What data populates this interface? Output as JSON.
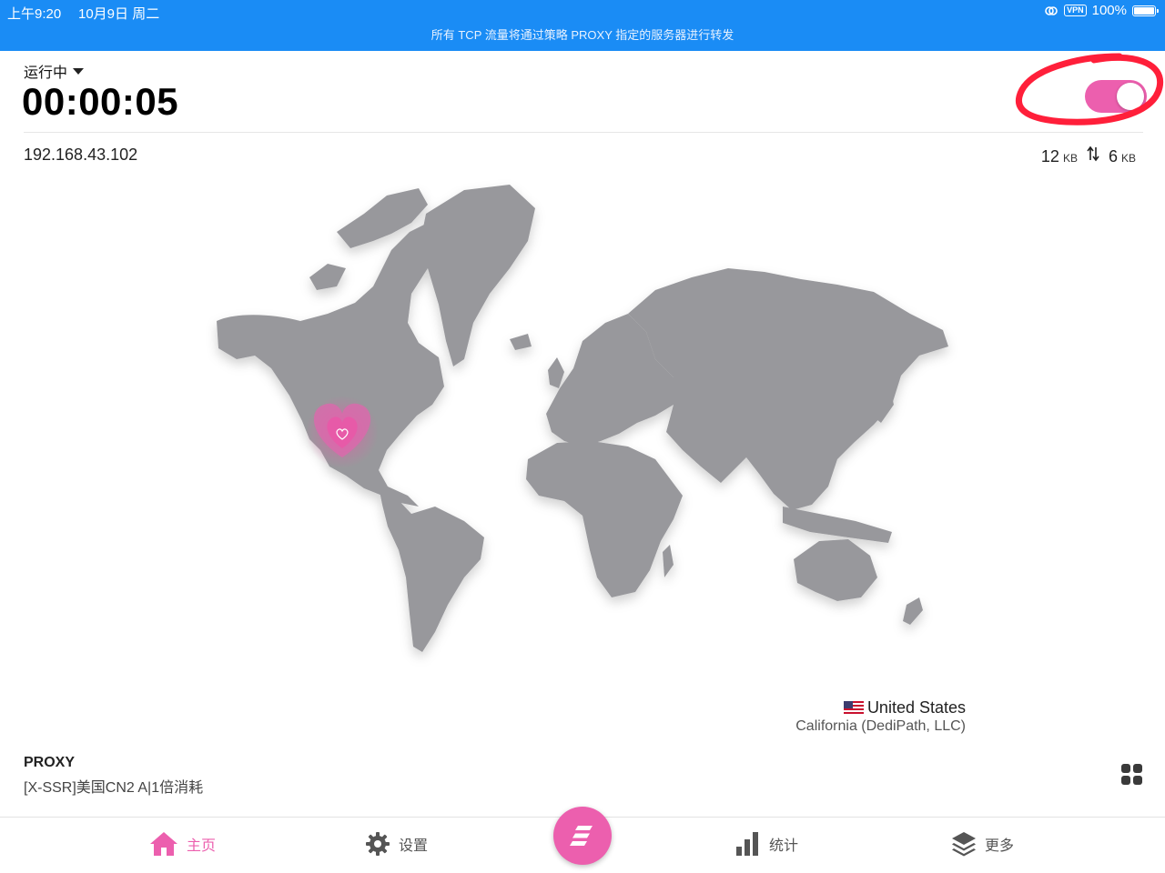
{
  "status_bar": {
    "time": "上午9:20",
    "date": "10月9日 周二",
    "vpn_badge": "VPN",
    "battery": "100%",
    "message": "所有 TCP 流量将通过策略 PROXY 指定的服务器进行转发"
  },
  "header": {
    "status": "运行中",
    "timer": "00:00:05",
    "toggle_on": true
  },
  "info": {
    "ip": "192.168.43.102",
    "upload_value": "12",
    "upload_unit": "KB",
    "download_value": "6",
    "download_unit": "KB",
    "transfer_icon": "up-down-arrows-icon"
  },
  "location": {
    "country": "United States",
    "region": "California (DediPath, LLC)",
    "flag": "us-flag-icon"
  },
  "proxy": {
    "title": "PROXY",
    "node": "[X-SSR]美国CN2 A|1倍消耗"
  },
  "tabs": [
    {
      "label": "主页",
      "icon": "home-icon",
      "active": true
    },
    {
      "label": "设置",
      "icon": "gear-icon",
      "active": false
    },
    {
      "label": "统计",
      "icon": "bar-chart-icon",
      "active": false
    },
    {
      "label": "更多",
      "icon": "layers-icon",
      "active": false
    }
  ],
  "colors": {
    "status_bar": "#1a8cf5",
    "accent": "#ec5fae",
    "map_land": "#98989c"
  }
}
